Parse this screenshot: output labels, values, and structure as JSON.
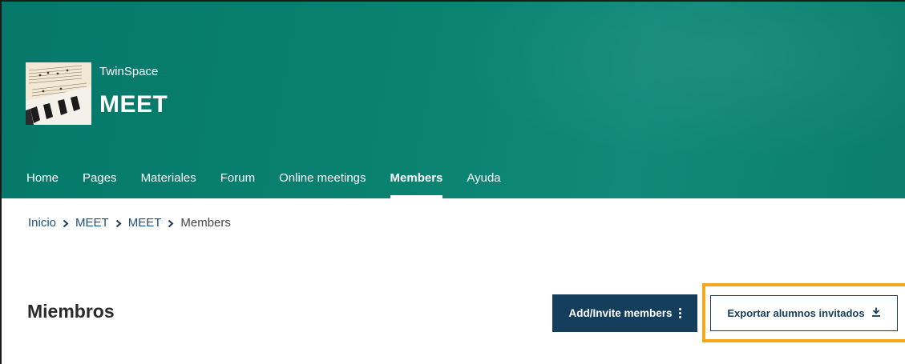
{
  "header": {
    "site_sub": "TwinSpace",
    "site_title": "MEET",
    "background_color": "#0a8270"
  },
  "nav": {
    "items": [
      {
        "label": "Home"
      },
      {
        "label": "Pages"
      },
      {
        "label": "Materiales"
      },
      {
        "label": "Forum"
      },
      {
        "label": "Online meetings"
      },
      {
        "label": "Members",
        "active": true
      },
      {
        "label": "Ayuda"
      }
    ]
  },
  "breadcrumb": {
    "items": [
      "Inicio",
      "MEET",
      "MEET",
      "Members"
    ]
  },
  "main": {
    "title": "Miembros",
    "add_invite_label": "Add/Invite members",
    "export_label": "Exportar alumnos invitados",
    "primary_color": "#153d5c",
    "highlight_color": "#f5a81b"
  }
}
